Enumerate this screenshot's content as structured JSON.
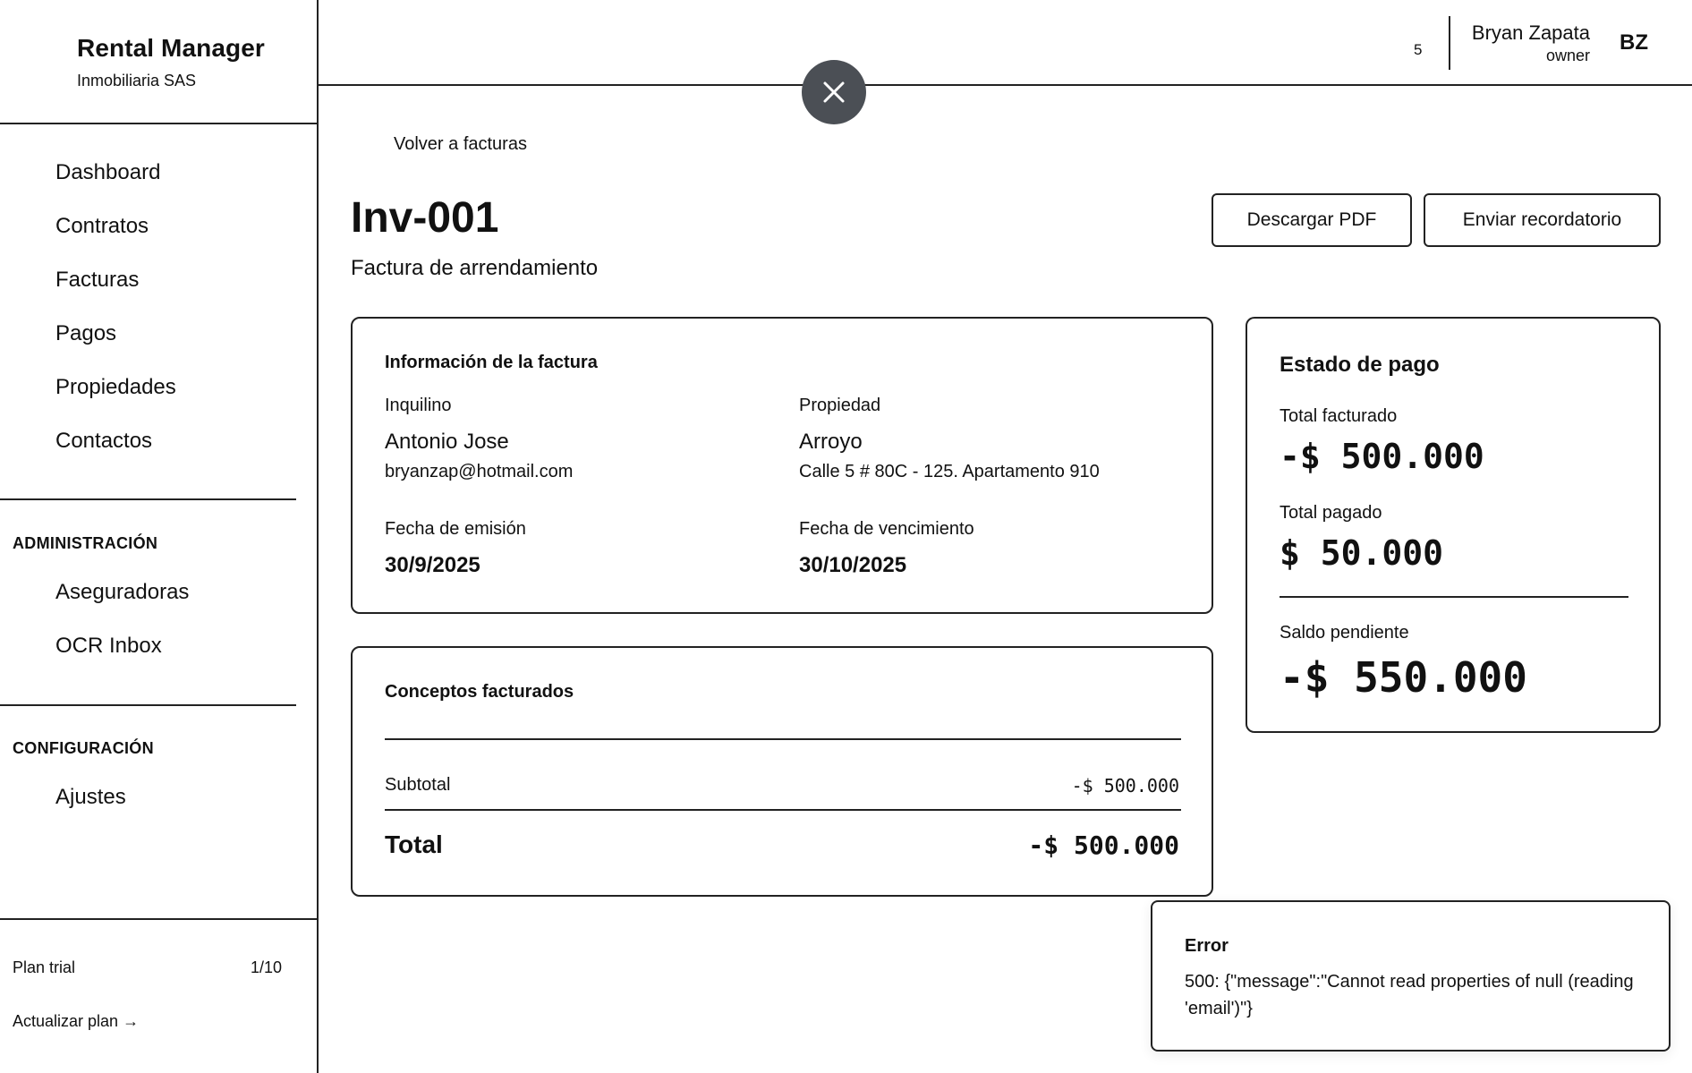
{
  "sidebar": {
    "brand_title": "Rental Manager",
    "brand_sub": "Inmobiliaria SAS",
    "nav": [
      "Dashboard",
      "Contratos",
      "Facturas",
      "Pagos",
      "Propiedades",
      "Contactos"
    ],
    "admin_heading": "ADMINISTRACIÓN",
    "admin_items": [
      "Aseguradoras",
      "OCR Inbox"
    ],
    "config_heading": "CONFIGURACIÓN",
    "config_items": [
      "Ajustes"
    ],
    "plan_label": "Plan trial",
    "plan_count": "1/10",
    "plan_upgrade": "Actualizar plan →"
  },
  "header": {
    "notification_count": "5",
    "user_name": "Bryan Zapata",
    "user_role": "owner",
    "avatar_initials": "BZ"
  },
  "main": {
    "back_link": "Volver a facturas",
    "title": "Inv-001",
    "subtitle": "Factura de arrendamiento",
    "download_label": "Descargar PDF",
    "reminder_label": "Enviar recordatorio"
  },
  "info_card": {
    "title": "Información de la factura",
    "tenant_label": "Inquilino",
    "tenant_name": "Antonio Jose",
    "tenant_email": "bryanzap@hotmail.com",
    "property_label": "Propiedad",
    "property_name": "Arroyo",
    "property_address": "Calle 5 # 80C - 125. Apartamento 910",
    "issue_label": "Fecha de emisión",
    "issue_date": "30/9/2025",
    "due_label": "Fecha de vencimiento",
    "due_date": "30/10/2025"
  },
  "concepts_card": {
    "title": "Conceptos facturados",
    "subtotal_label": "Subtotal",
    "subtotal_value": "-$ 500.000",
    "total_label": "Total",
    "total_value": "-$ 500.000"
  },
  "status_card": {
    "title": "Estado de pago",
    "billed_label": "Total facturado",
    "billed_value": "-$ 500.000",
    "paid_label": "Total pagado",
    "paid_value": "$ 50.000",
    "pending_label": "Saldo pendiente",
    "pending_value": "-$ 550.000"
  },
  "error_toast": {
    "title": "Error",
    "message": "500: {\"message\":\"Cannot read properties of null (reading 'email')\"}"
  }
}
